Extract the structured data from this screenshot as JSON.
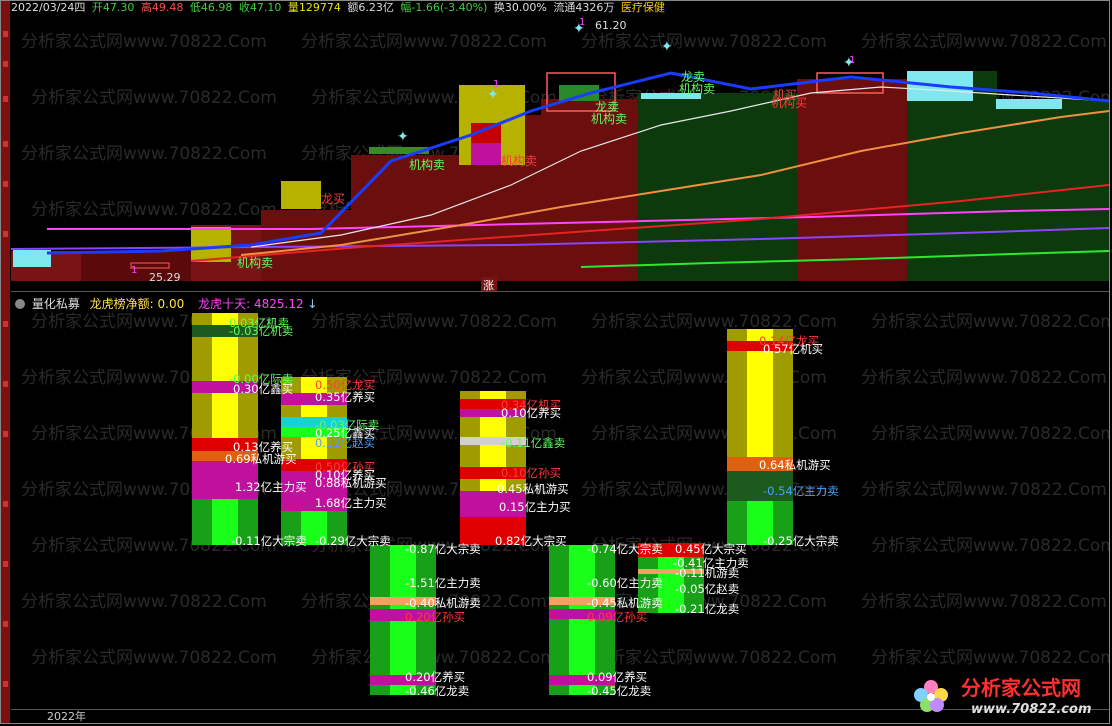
{
  "header": {
    "date": "2022/03/24四",
    "open": "开47.30",
    "high": "高49.48",
    "low": "低46.98",
    "close": "收47.10",
    "volume": "量129774",
    "amount": "额6.23亿",
    "change": "幅-1.66(-3.40%)",
    "turnover": "换30.00%",
    "float": "流通4326万",
    "sector": "医疗保健"
  },
  "upper": {
    "price_high_label": "61.20",
    "price_low_label": "25.29",
    "zhang_label": "涨",
    "markers": [
      "1",
      "1",
      "1",
      "1"
    ],
    "annotations": [
      {
        "text": "机构卖",
        "color": "#5cff5c"
      },
      {
        "text": "机构卖",
        "color": "#5cff5c"
      },
      {
        "text": "机构卖",
        "color": "#5cff5c"
      },
      {
        "text": "机构卖",
        "color": "#5cff5c"
      },
      {
        "text": "机构卖",
        "color": "#5cff5c"
      },
      {
        "text": "龙卖",
        "color": "#5cff5c"
      },
      {
        "text": "龙卖",
        "color": "#5cff5c"
      },
      {
        "text": "龙买",
        "color": "#ff3b3b"
      },
      {
        "text": "机买",
        "color": "#ff3b3b"
      },
      {
        "text": "机构买",
        "color": "#ff3b3b"
      },
      {
        "text": "机构买",
        "color": "#ff3b3b"
      }
    ]
  },
  "indicator": {
    "title": "量化私募",
    "net_label": "龙虎榜净额:",
    "net_value": "0.00",
    "ten_day_label": "龙虎十天:",
    "ten_day_value": "4825.12",
    "arrow": "↓"
  },
  "lower_labels": [
    {
      "text": "0.03亿机卖",
      "color": "#5cff5c"
    },
    {
      "text": "-0.03亿机卖",
      "color": "#5cff5c"
    },
    {
      "text": "-0.00亿际卖",
      "color": "#5cff5c"
    },
    {
      "text": "0.30亿鑫买",
      "color": "#ffffff"
    },
    {
      "text": "0.13亿养买",
      "color": "#ffffff"
    },
    {
      "text": "0.69私机游买",
      "color": "#ffffff"
    },
    {
      "text": "1.32亿主力买",
      "color": "#ffffff"
    },
    {
      "text": "-0.11亿大宗卖",
      "color": "#ffffff"
    },
    {
      "text": "0.50亿龙买",
      "color": "#ff3b3b"
    },
    {
      "text": "0.35亿养买",
      "color": "#ffffff"
    },
    {
      "text": "-0.03亿际卖",
      "color": "#5cff5c"
    },
    {
      "text": "0.25亿鑫买",
      "color": "#ffffff"
    },
    {
      "text": "0.12亿赵买",
      "color": "#4aa0ff"
    },
    {
      "text": "0.50亿孙买",
      "color": "#ff3b3b"
    },
    {
      "text": "0.10亿养买",
      "color": "#ffffff"
    },
    {
      "text": "0.88私机游买",
      "color": "#ffffff"
    },
    {
      "text": "1.68亿主力买",
      "color": "#ffffff"
    },
    {
      "text": "-0.29亿大宗卖",
      "color": "#ffffff"
    },
    {
      "text": "0.34亿机买",
      "color": "#ff3b3b"
    },
    {
      "text": "0.10亿养买",
      "color": "#ffffff"
    },
    {
      "text": "-0.11亿鑫卖",
      "color": "#5cff5c"
    },
    {
      "text": "0.10亿孙买",
      "color": "#ff3b3b"
    },
    {
      "text": "0.45私机游买",
      "color": "#ffffff"
    },
    {
      "text": "0.15亿主力买",
      "color": "#ffffff"
    },
    {
      "text": "0.82亿大宗买",
      "color": "#ffffff"
    },
    {
      "text": "-0.87亿大宗卖",
      "color": "#ffffff"
    },
    {
      "text": "-1.51亿主力卖",
      "color": "#ffffff"
    },
    {
      "text": "-0.40私机游卖",
      "color": "#ffffff"
    },
    {
      "text": "0.20亿孙买",
      "color": "#ff3b3b"
    },
    {
      "text": "0.20亿养买",
      "color": "#ffffff"
    },
    {
      "text": "-0.46亿龙卖",
      "color": "#ffffff"
    },
    {
      "text": "-0.74亿大宗卖",
      "color": "#ffffff"
    },
    {
      "text": "-0.60亿主力卖",
      "color": "#ffffff"
    },
    {
      "text": "-0.45私机游卖",
      "color": "#ffffff"
    },
    {
      "text": "0.09亿孙买",
      "color": "#ff3b3b"
    },
    {
      "text": "0.09亿养买",
      "color": "#ffffff"
    },
    {
      "text": "-0.45亿龙卖",
      "color": "#ffffff"
    },
    {
      "text": "0.45亿大宗买",
      "color": "#ffffff"
    },
    {
      "text": "-0.41亿主力卖",
      "color": "#ffffff"
    },
    {
      "text": "-0.11机游卖",
      "color": "#ffffff"
    },
    {
      "text": "-0.05亿赵卖",
      "color": "#ffffff"
    },
    {
      "text": "-0.21亿龙卖",
      "color": "#ffffff"
    },
    {
      "text": "0.14亿龙买",
      "color": "#ff3b3b"
    },
    {
      "text": "0.57亿机买",
      "color": "#ffffff"
    },
    {
      "text": "0.64私机游买",
      "color": "#ffffff"
    },
    {
      "text": "-0.54亿主力卖",
      "color": "#4aa0ff"
    },
    {
      "text": "-0.25亿大宗卖",
      "color": "#ffffff"
    }
  ],
  "watermark": "分析家公式网www.70822.Com",
  "logo": {
    "name": "分析家公式网",
    "url": "www.70822.com"
  },
  "axis": {
    "year": "2022年"
  }
}
